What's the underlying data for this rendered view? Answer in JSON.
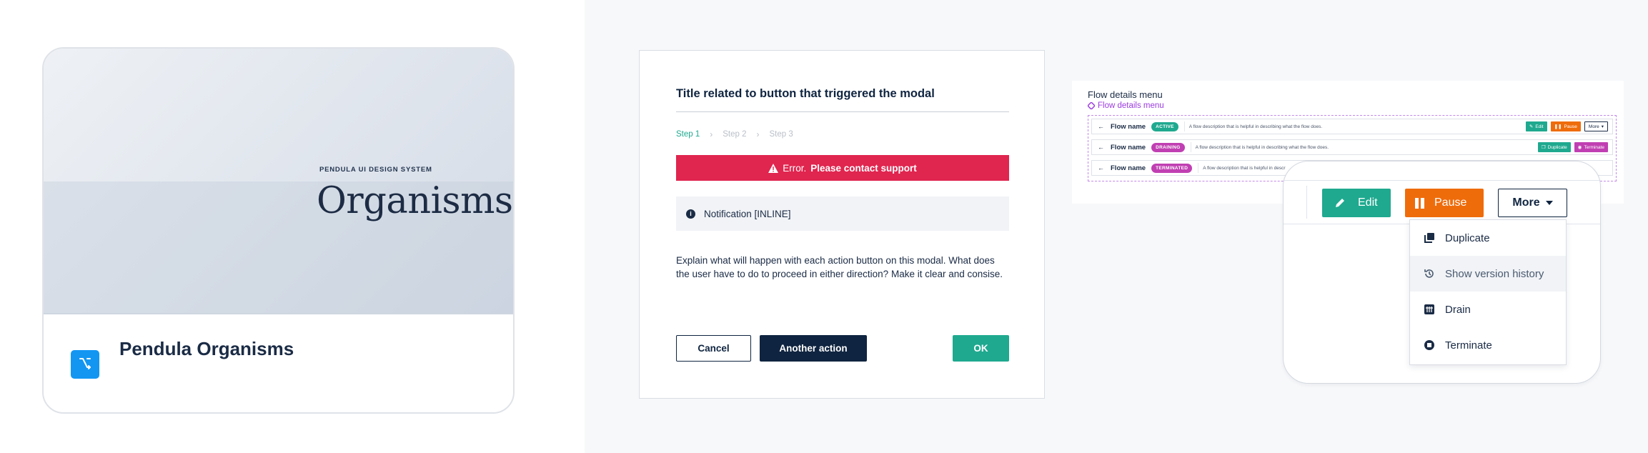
{
  "card": {
    "kicker": "PENDULA UI DESIGN SYSTEM",
    "cover_title": "Organisms",
    "title": "Pendula Organisms",
    "icon": "branch-icon",
    "accent": "#1296f2"
  },
  "modal": {
    "title": "Title related to button that triggered the modal",
    "steps": [
      "Step 1",
      "Step 2",
      "Step 3"
    ],
    "error_prefix": "Error.",
    "error_text": "Please contact support",
    "notification": "Notification [INLINE]",
    "body": "Explain what will happen with each action button on this modal. What does the user have to do to proceed in either direction? Make it clear and consise.",
    "cancel_label": "Cancel",
    "another_label": "Another action",
    "ok_label": "OK",
    "colors": {
      "error": "#e0254f",
      "primary": "#0f2440",
      "ok": "#1fa98f"
    }
  },
  "flow_panel": {
    "heading": "Flow details menu",
    "component_label": "Flow details menu",
    "rows": [
      {
        "name": "Flow name",
        "status": "ACTIVE",
        "desc": "A flow description that is helpful in describing what the flow does.",
        "actions": [
          "Edit",
          "Pause",
          "More"
        ]
      },
      {
        "name": "Flow name",
        "status": "DRAINING",
        "desc": "A flow description that is helpful in describing what the flow does.",
        "actions": [
          "Duplicate",
          "Terminate"
        ]
      },
      {
        "name": "Flow name",
        "status": "TERMINATED",
        "desc": "A flow description that is helpful in descr"
      }
    ]
  },
  "zoom": {
    "edit_label": "Edit",
    "pause_label": "Pause",
    "more_label": "More",
    "menu": [
      {
        "label": "Duplicate",
        "icon": "duplicate-icon"
      },
      {
        "label": "Show version history",
        "icon": "history-icon"
      },
      {
        "label": "Drain",
        "icon": "drain-icon"
      },
      {
        "label": "Terminate",
        "icon": "terminate-icon"
      }
    ],
    "colors": {
      "edit": "#1fa98f",
      "pause": "#ef6c0b"
    }
  }
}
